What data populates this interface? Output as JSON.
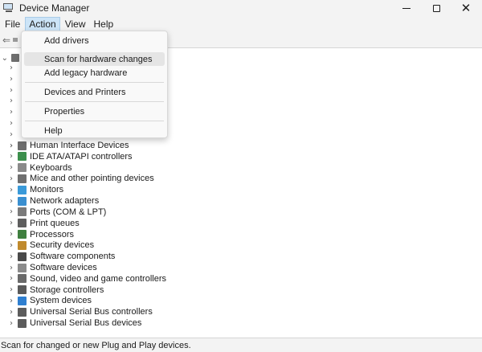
{
  "window": {
    "title": "Device Manager",
    "close_glyph": "✕"
  },
  "menubar": {
    "items": [
      "File",
      "Action",
      "View",
      "Help"
    ],
    "active": "Action"
  },
  "toolbar": {
    "back_glyph": "⇐"
  },
  "tree": {
    "root_chevron": "⌄",
    "chevron": "›",
    "items": [
      {
        "label": "Human Interface Devices",
        "icon": "hid-icon",
        "color": "#6d6d6d"
      },
      {
        "label": "IDE ATA/ATAPI controllers",
        "icon": "ide-controller-icon",
        "color": "#3c8f4c"
      },
      {
        "label": "Keyboards",
        "icon": "keyboard-icon",
        "color": "#8a8a8a"
      },
      {
        "label": "Mice and other pointing devices",
        "icon": "mouse-icon",
        "color": "#6f6f6f"
      },
      {
        "label": "Monitors",
        "icon": "monitor-icon",
        "color": "#3a9ad9"
      },
      {
        "label": "Network adapters",
        "icon": "network-icon",
        "color": "#3a8fd0"
      },
      {
        "label": "Ports (COM & LPT)",
        "icon": "port-icon",
        "color": "#7a7a7a"
      },
      {
        "label": "Print queues",
        "icon": "printer-icon",
        "color": "#5e5e5e"
      },
      {
        "label": "Processors",
        "icon": "processor-icon",
        "color": "#3f7f3f"
      },
      {
        "label": "Security devices",
        "icon": "security-icon",
        "color": "#c08a2d"
      },
      {
        "label": "Software components",
        "icon": "software-component-icon",
        "color": "#4a4a4a"
      },
      {
        "label": "Software devices",
        "icon": "software-device-icon",
        "color": "#8b8b8b"
      },
      {
        "label": "Sound, video and game controllers",
        "icon": "speaker-icon",
        "color": "#6a6a6a"
      },
      {
        "label": "Storage controllers",
        "icon": "storage-icon",
        "color": "#5a5a5a"
      },
      {
        "label": "System devices",
        "icon": "system-icon",
        "color": "#2f7fd0"
      },
      {
        "label": "Universal Serial Bus controllers",
        "icon": "usb-icon",
        "color": "#5c5c5c"
      },
      {
        "label": "Universal Serial Bus devices",
        "icon": "usb-device-icon",
        "color": "#5c5c5c"
      }
    ]
  },
  "action_menu": {
    "add_drivers": "Add drivers",
    "scan": "Scan for hardware changes",
    "add_legacy": "Add legacy hardware",
    "devices_printers": "Devices and Printers",
    "properties": "Properties",
    "help": "Help"
  },
  "statusbar": {
    "text": "Scan for changed or new Plug and Play devices."
  }
}
